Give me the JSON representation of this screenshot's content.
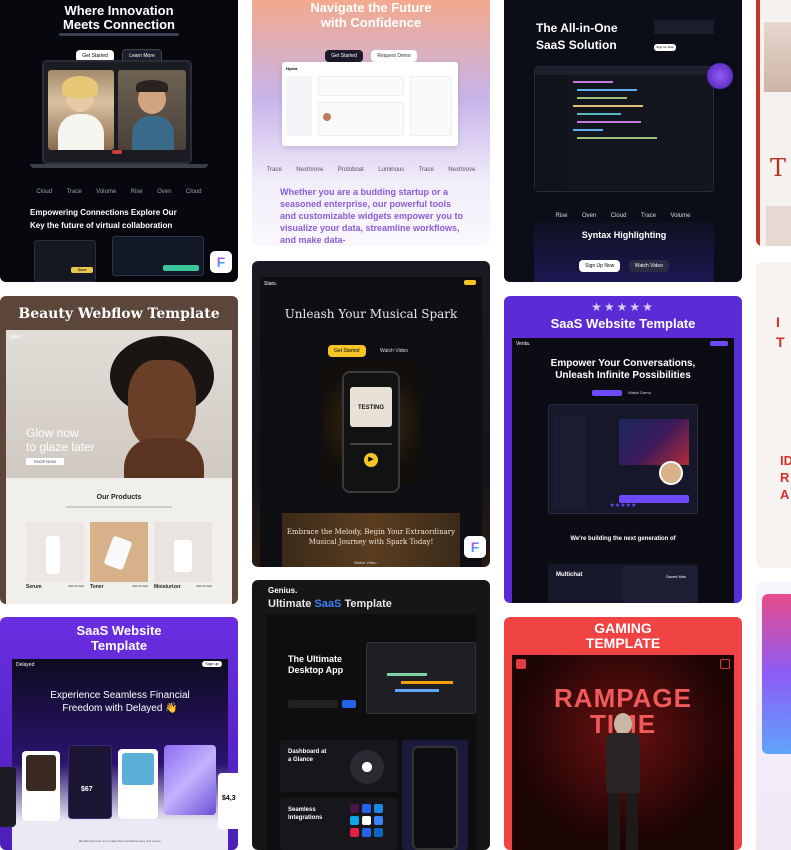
{
  "col1": {
    "card1": {
      "title_line1": "Where Innovation",
      "title_line2": "Meets Connection",
      "buttons": [
        "Get Started",
        "Learn More"
      ],
      "partner_logos": [
        "Cloud",
        "Trace",
        "Volume",
        "Rise",
        "Oven",
        "Cloud"
      ],
      "headline": "Empowering Connections Explore Our Key the future of virtual collaboration",
      "mini_btn": "Save"
    },
    "card2": {
      "title": "Beauty Webflow Template",
      "brand": "glaze",
      "hero_line1": "Glow now",
      "hero_line2": "to glaze later",
      "shop_btn": "SHOP NOW",
      "products_title": "Our Products",
      "products": [
        {
          "name": "Serum",
          "price": "Add To Cart"
        },
        {
          "name": "Toner",
          "price": "Add To Cart"
        },
        {
          "name": "Moisturizer",
          "price": "Add To Cart"
        }
      ]
    },
    "card3": {
      "title_line1": "SaaS Website",
      "title_line2": "Template",
      "brand": "Delayed",
      "signup": "Sign up",
      "headline_line1": "Experience Seamless Financial",
      "headline_line2": "Freedom with Delayed 👋",
      "amount1": "$67",
      "amount2": "$4,3",
      "footer": "Brands that trust us to make their transitions easy and secure"
    }
  },
  "col2": {
    "card1": {
      "title_line1": "Navigate the Future",
      "title_line2": "with Confidence",
      "buttons": [
        "Get Started",
        "Request Demo"
      ],
      "brand": "Hydra",
      "logos": [
        "Trace",
        "Nextmove",
        "Protoboat",
        "Luminous",
        "Trace",
        "Nextmove"
      ],
      "tagline": "Whether you are a budding startup or a seasoned enterprise, our powerful tools and customizable widgets empower you to visualize your data, streamline workflows, and make data-"
    },
    "card2": {
      "brand": "Stars.",
      "title": "Unleash Your Musical Spark",
      "buttons": [
        "Get Started",
        "Watch Video"
      ],
      "album": "TESTING",
      "footer_line1": "Embrace the Melody, Begin Your Extraordinary",
      "footer_line2": "Musical Journey with Spark Today!",
      "cta": "Watch Video"
    },
    "card3": {
      "brand": "Genius.",
      "title_prefix": "Ultimate",
      "title_accent": "SaaS",
      "title_suffix": "Template",
      "app_title_line1": "The Ultimate",
      "app_title_line2": "Desktop App",
      "feature1_line1": "Dashboard at",
      "feature1_line2": "a Glance",
      "feature2_line1": "Seamless",
      "feature2_line2": "Integrations"
    }
  },
  "col3": {
    "card1": {
      "title_line1": "The All-in-One",
      "title_line2": "SaaS Solution",
      "cta": "Sign Up Now",
      "logos": [
        "Rise",
        "Oven",
        "Cloud",
        "Trace",
        "Volume"
      ],
      "section_title": "Syntax Highlighting",
      "buttons": [
        "Sign Up Now",
        "Watch Video"
      ]
    },
    "card2": {
      "stars": "★★★★★",
      "title": "SaaS Website Template",
      "brand": "Venta.",
      "headline_line1": "Empower Your Conversations,",
      "headline_line2": "Unleash Infinite Possibilities",
      "watch": "Watch Demo",
      "section_title": "We're building the next generation of",
      "feature": "Multichat",
      "saved": "Saved Mes"
    },
    "card3": {
      "title_line1": "GAMING",
      "title_line2": "TEMPLATE",
      "hero_line1": "RAMPAGE",
      "hero_line2": "TIME"
    }
  },
  "col4": {
    "card1_letter": "T",
    "card2_letters": [
      "I",
      "T",
      "ID",
      "R",
      "A"
    ]
  },
  "colors": {
    "purple": "#5b2bd6",
    "beauty_header": "#5b4639",
    "gaming_red": "#f04343",
    "genius_dark": "#161616",
    "navy": "#0b0d18"
  }
}
